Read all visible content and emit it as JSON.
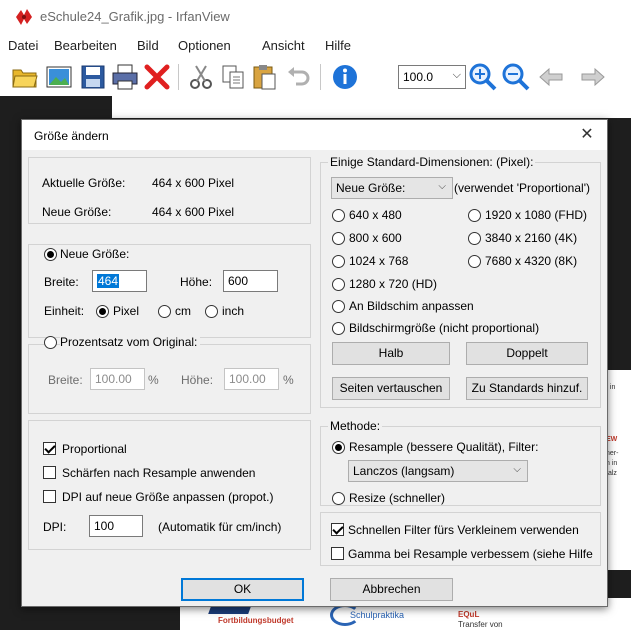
{
  "window": {
    "title": "eSchule24_Grafik.jpg - IrfanView"
  },
  "menu": [
    "Datei",
    "Bearbeiten",
    "Bild",
    "Optionen",
    "Ansicht",
    "Hilfe"
  ],
  "toolbar": {
    "zoom_value": "100.0",
    "icons": [
      "open-folder-icon",
      "slideshow-icon",
      "save-icon",
      "print-icon",
      "delete-icon",
      "cut-icon",
      "copy-icon",
      "paste-icon",
      "undo-icon",
      "info-icon",
      "zoom-in-icon",
      "zoom-out-icon",
      "previous-icon",
      "next-icon"
    ]
  },
  "background": {
    "brand1": "Fortbildungsbudget",
    "brand2": "Schulpraktika",
    "brand3": "EQuL",
    "brand3_sub": "Transfer von",
    "side_lines": [
      "t in",
      "EW",
      "ner-",
      "n in",
      "falz"
    ]
  },
  "dialog": {
    "title": "Größe ändern",
    "current_size_label": "Aktuelle Größe:",
    "current_size_value": "464  x  600  Pixel",
    "new_size_label": "Neue Größe:",
    "new_size_value": "464  x  600  Pixel",
    "new_size_group": {
      "radio_label": "Neue Größe:",
      "width_label": "Breite:",
      "width_value": "464",
      "height_label": "Höhe:",
      "height_value": "600",
      "unit_label": "Einheit:",
      "unit_pixel": "Pixel",
      "unit_cm": "cm",
      "unit_inch": "inch"
    },
    "percent_group": {
      "radio_label": "Prozentsatz vom Original:",
      "width_label": "Breite:",
      "width_value": "100.00",
      "height_label": "Höhe:",
      "height_value": "100.00",
      "pct": "%"
    },
    "options": {
      "proportional": "Proportional",
      "sharpen": "Schärfen nach Resample anwenden",
      "dpi_adjust": "DPI auf neue Größe anpassen (propot.)",
      "dpi_label": "DPI:",
      "dpi_value": "100",
      "dpi_note": "(Automatik für cm/inch)"
    },
    "standard": {
      "legend": "Einige Standard-Dimensionen: (Pixel):",
      "combo_value": "Neue Größe:",
      "combo_note": "(verwendet 'Proportional')",
      "sizes_left": [
        "640 x 480",
        "800 x 600",
        "1024 x 768",
        "1280 x 720   (HD)"
      ],
      "sizes_right": [
        "1920 x 1080 (FHD)",
        "3840 x 2160 (4K)",
        "7680 x 4320 (8K)"
      ],
      "fit_screen": "An Bildschim anpassen",
      "screen_size": "Bildschirmgröße (nicht proportional)",
      "half": "Halb",
      "double": "Doppelt",
      "swap": "Seiten vertauschen",
      "add_standard": "Zu Standards hinzuf."
    },
    "method": {
      "legend": "Methode:",
      "resample": "Resample (bessere Qualität), Filter:",
      "filter_value": "Lanczos (langsam)",
      "resize": "Resize (schneller)",
      "fast_filter": "Schnellen Filter fürs Verkleinem verwenden",
      "gamma": "Gamma bei Resample verbessem (siehe Hilfe"
    },
    "ok": "OK",
    "cancel": "Abbrechen"
  }
}
